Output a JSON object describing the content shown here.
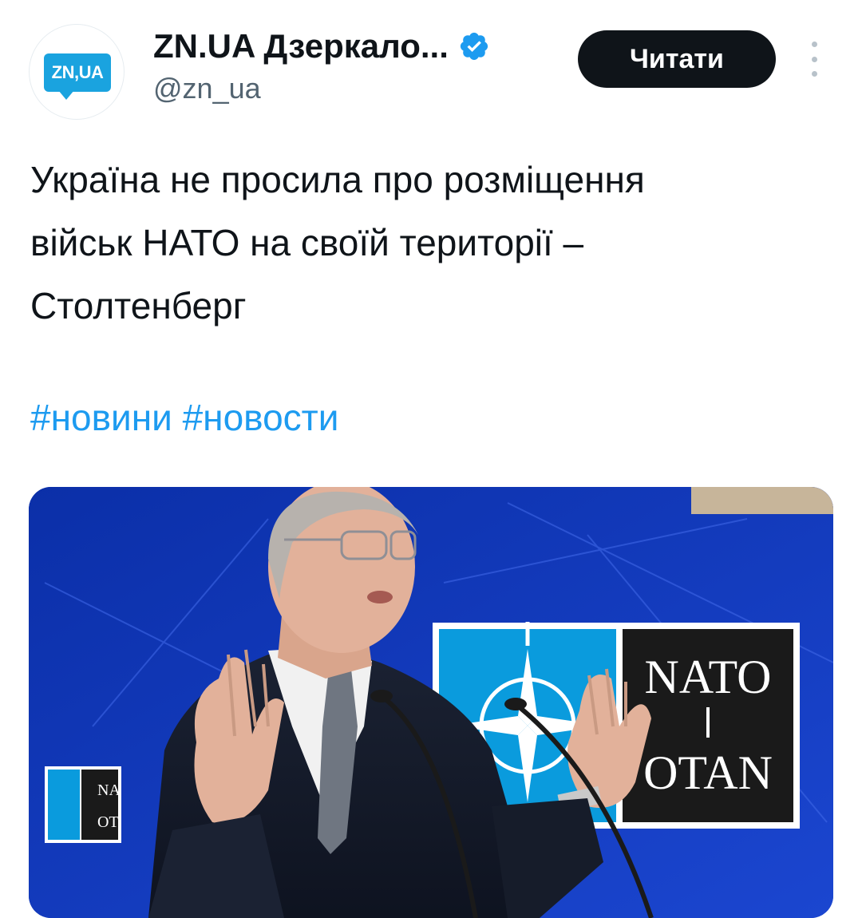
{
  "account": {
    "avatar_text": "ZN,UA",
    "display_name": "ZN.UA Дзеркало...",
    "handle": "@zn_ua",
    "verified": true
  },
  "follow_button": {
    "label": "Читати"
  },
  "more_button": {
    "icon": "more-vertical-icon"
  },
  "tweet": {
    "lines": [
      "Україна не просила про розміщення",
      "військ НАТО на своїй території –",
      "Столтенберг"
    ],
    "hashtags": [
      "#новини",
      "#новости"
    ]
  },
  "media": {
    "description": "photo",
    "sign_top": "NATO",
    "sign_bottom": "OTAN",
    "side_sign_top": "NA",
    "side_sign_bottom": "OT"
  },
  "colors": {
    "link": "#1d9bf0",
    "verified": "#1d9bf0",
    "button_bg": "#0f1419",
    "avatar_brand": "#1aa3df"
  }
}
